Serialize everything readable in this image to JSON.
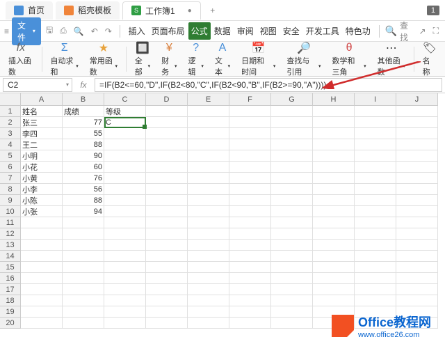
{
  "tabs": {
    "home": "首页",
    "template": "稻壳模板",
    "workbook": "工作簿1",
    "badge": "1"
  },
  "menu": {
    "file": "文件",
    "search": "查找",
    "tabs": [
      "插入",
      "页面布局",
      "公式",
      "数据",
      "审阅",
      "视图",
      "安全",
      "开发工具",
      "特色功"
    ]
  },
  "ribbon": {
    "insert_fn": "插入函数",
    "autosum": "自动求和",
    "common": "常用函数",
    "all": "全部",
    "finance": "财务",
    "logic": "逻辑",
    "text": "文本",
    "datetime": "日期和时间",
    "lookup": "查找与引用",
    "math": "数学和三角",
    "other": "其他函数",
    "name": "名称"
  },
  "namebox": "C2",
  "formula": "=IF(B2<=60,\"D\",IF(B2<80,\"C\",IF(B2<90,\"B\",IF(B2>=90,\"A\"))))",
  "cols": [
    "A",
    "B",
    "C",
    "D",
    "E",
    "F",
    "G",
    "H",
    "I",
    "J"
  ],
  "rows": [
    "1",
    "2",
    "3",
    "4",
    "5",
    "6",
    "7",
    "8",
    "9",
    "10",
    "11",
    "12",
    "13",
    "14",
    "15",
    "16",
    "17",
    "18",
    "19",
    "20"
  ],
  "headerRow": {
    "a": "姓名",
    "b": "成绩",
    "c": "等级"
  },
  "data": [
    {
      "a": "张三",
      "b": "77",
      "c": "C"
    },
    {
      "a": "李四",
      "b": "55",
      "c": ""
    },
    {
      "a": "王二",
      "b": "88",
      "c": ""
    },
    {
      "a": "小明",
      "b": "90",
      "c": ""
    },
    {
      "a": "小花",
      "b": "60",
      "c": ""
    },
    {
      "a": "小黄",
      "b": "76",
      "c": ""
    },
    {
      "a": "小李",
      "b": "56",
      "c": ""
    },
    {
      "a": "小陈",
      "b": "88",
      "c": ""
    },
    {
      "a": "小张",
      "b": "94",
      "c": ""
    }
  ],
  "watermark": {
    "title": "Office教程网",
    "url": "www.office26.com"
  }
}
